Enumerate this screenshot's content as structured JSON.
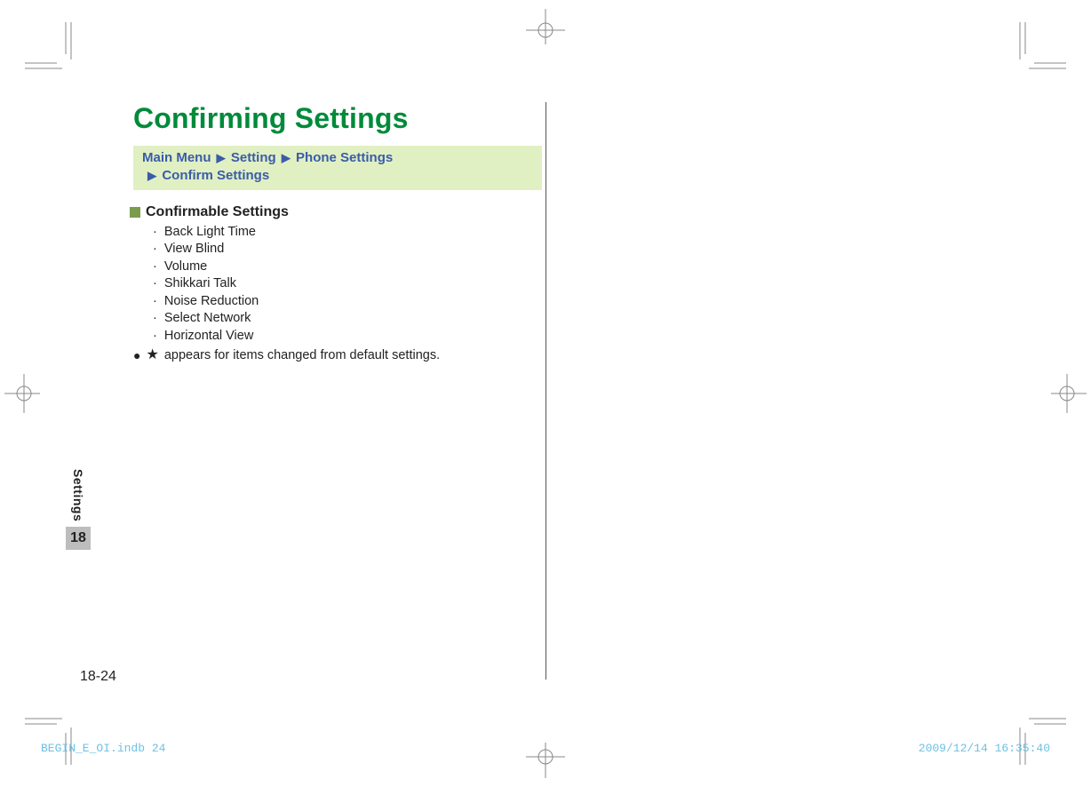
{
  "title": "Confirming Settings",
  "breadcrumb": {
    "segments": [
      "Main Menu",
      "Setting",
      "Phone Settings",
      "Confirm Settings"
    ]
  },
  "subhead": "Confirmable Settings",
  "items": [
    "Back Light Time",
    "View Blind",
    "Volume",
    "Shikkari Talk",
    "Noise Reduction",
    "Select Network",
    "Horizontal View"
  ],
  "note": "appears for items changed from default settings.",
  "side": {
    "label": "Settings",
    "chapter": "18"
  },
  "page_number": "18-24",
  "footer": {
    "file": "BEGIN_E_OI.indb   24",
    "timestamp": "2009/12/14   16:35:40"
  }
}
